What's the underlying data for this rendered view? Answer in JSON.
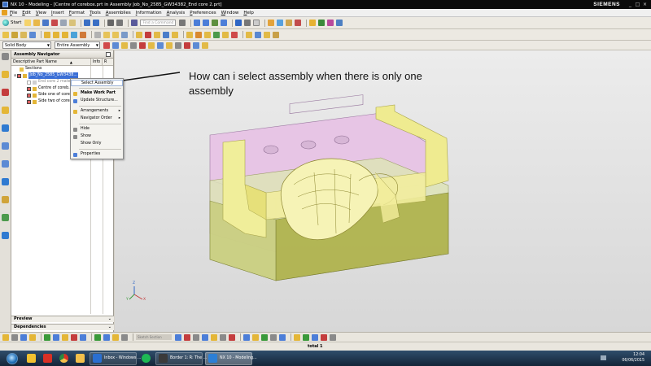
{
  "window": {
    "title": "NX 10 - Modeling - [Centre of corebox.prt in Assembly Job_No_2585_GW34382_End core 2.prt]",
    "brand": "SIEMENS",
    "controls": [
      "_",
      "□",
      "×"
    ]
  },
  "menubar": {
    "items": [
      "File",
      "Edit",
      "View",
      "Insert",
      "Format",
      "Tools",
      "Assemblies",
      "Information",
      "Analysis",
      "Preferences",
      "Window",
      "Help"
    ]
  },
  "toolbar": {
    "start_label": "Start",
    "find_command_placeholder": "Find a Command",
    "selection_filter": "Solid Body",
    "selection_scope": "Entire Assembly"
  },
  "navigator": {
    "title": "Assembly Navigator",
    "columns": [
      "Descriptive Part Name",
      "Info",
      "R"
    ],
    "rows": [
      {
        "label": "Sections",
        "type": "folder"
      },
      {
        "label": "Job_No_2585_GW3438...",
        "type": "assembly",
        "selected": true
      },
      {
        "label": "End core 2 mater...",
        "type": "component",
        "grey": true
      },
      {
        "label": "Centre of coreb...",
        "type": "component"
      },
      {
        "label": "Side one of core...",
        "type": "component"
      },
      {
        "label": "Side two of core...",
        "type": "component"
      }
    ],
    "bottom_panels": [
      "Preview",
      "Dependencies"
    ]
  },
  "context_menu": {
    "items": [
      {
        "label": "Select Assembly",
        "hover": true
      },
      {
        "label": "Make Work Part",
        "bold": true
      },
      {
        "label": "Update Structure..."
      },
      {
        "label": "Arrangements",
        "submenu": true
      },
      {
        "label": "Navigator Order",
        "submenu": true
      },
      {
        "label": "Hide"
      },
      {
        "label": "Show"
      },
      {
        "label": "Show Only"
      },
      {
        "label": "Properties"
      }
    ]
  },
  "viewport": {
    "annotation": "How can i select assembly when there is only one assembly",
    "triad_labels": [
      "X",
      "Y",
      "Z"
    ]
  },
  "bottombar": {
    "small_dropdown": "Sketch Section"
  },
  "statusbar": {
    "text": "total 1"
  },
  "taskbar": {
    "apps": [
      {
        "label": "",
        "color": "#f2c230"
      },
      {
        "label": "",
        "color": "#d93025"
      },
      {
        "label": "",
        "color": "#f3c04b"
      },
      {
        "label": "",
        "color": "#2b8a3e"
      },
      {
        "label": "Inbox - Windows ...",
        "color": "#2a6fd0"
      },
      {
        "label": "",
        "color": "#1db954"
      },
      {
        "label": "Border 1: R: The ...",
        "color": "#3a3a3a"
      },
      {
        "label": "NX 10 - Modeling...",
        "color": "#2c7fd6",
        "active": true
      }
    ],
    "time": "12:04",
    "date": "06/06/2015"
  }
}
